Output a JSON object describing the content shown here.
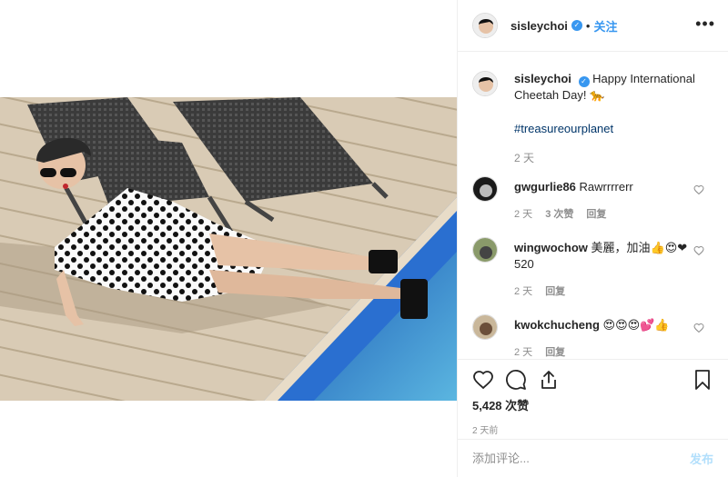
{
  "post": {
    "username": "sisleychoi",
    "follow_label": "关注",
    "separator": "•",
    "more_icon": "more-horizontal-icon"
  },
  "caption": {
    "username": "sisleychoi",
    "text": "Happy International Cheetah Day! 🐆",
    "hashtag": "#treasureourplanet",
    "time": "2 天"
  },
  "comments": [
    {
      "username": "gwgurlie86",
      "text": "Rawrrrrerr",
      "time": "2 天",
      "likes": "3 次赞",
      "reply": "回复"
    },
    {
      "username": "wingwochow",
      "text": "美麗，加油👍😍❤ 520",
      "time": "2 天",
      "likes": "",
      "reply": "回复"
    },
    {
      "username": "kwokchucheng",
      "text": "😍😍😍💕👍",
      "time": "2 天",
      "likes": "",
      "reply": "回复"
    }
  ],
  "actions": {
    "icons": [
      "heart-icon",
      "comment-icon",
      "share-icon",
      "bookmark-icon"
    ],
    "likes": "5,428 次赞",
    "date": "2 天前"
  },
  "add_comment": {
    "placeholder": "添加评论...",
    "post_label": "发布"
  },
  "colors": {
    "link": "#3897f0",
    "hashtag": "#003569",
    "muted": "#8e8e8e",
    "post_disabled": "#b2dffc"
  }
}
